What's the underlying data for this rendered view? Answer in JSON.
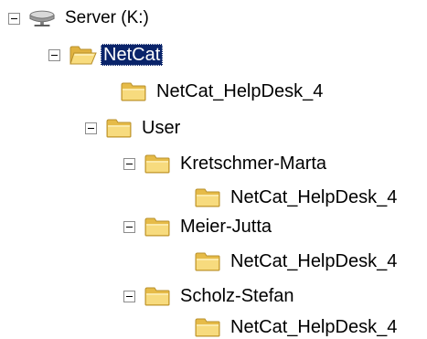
{
  "tree": {
    "server": {
      "label": "Server (K:)",
      "icon": "network-drive-icon"
    },
    "netcat": {
      "label": "NetCat",
      "icon": "folder-open-icon",
      "selected": true
    },
    "netcat_helpdesk": {
      "label": "NetCat_HelpDesk_4",
      "icon": "folder-icon"
    },
    "user": {
      "label": "User",
      "icon": "folder-icon"
    },
    "users": [
      {
        "label": "Kretschmer-Marta",
        "child_label": "NetCat_HelpDesk_4"
      },
      {
        "label": "Meier-Jutta",
        "child_label": "NetCat_HelpDesk_4"
      },
      {
        "label": "Scholz-Stefan",
        "child_label": "NetCat_HelpDesk_4"
      }
    ]
  },
  "colors": {
    "folder": "#f4d36a",
    "folder_dark": "#c9a33a",
    "selection": "#0a246a",
    "toggle_border": "#8c8c8c"
  }
}
